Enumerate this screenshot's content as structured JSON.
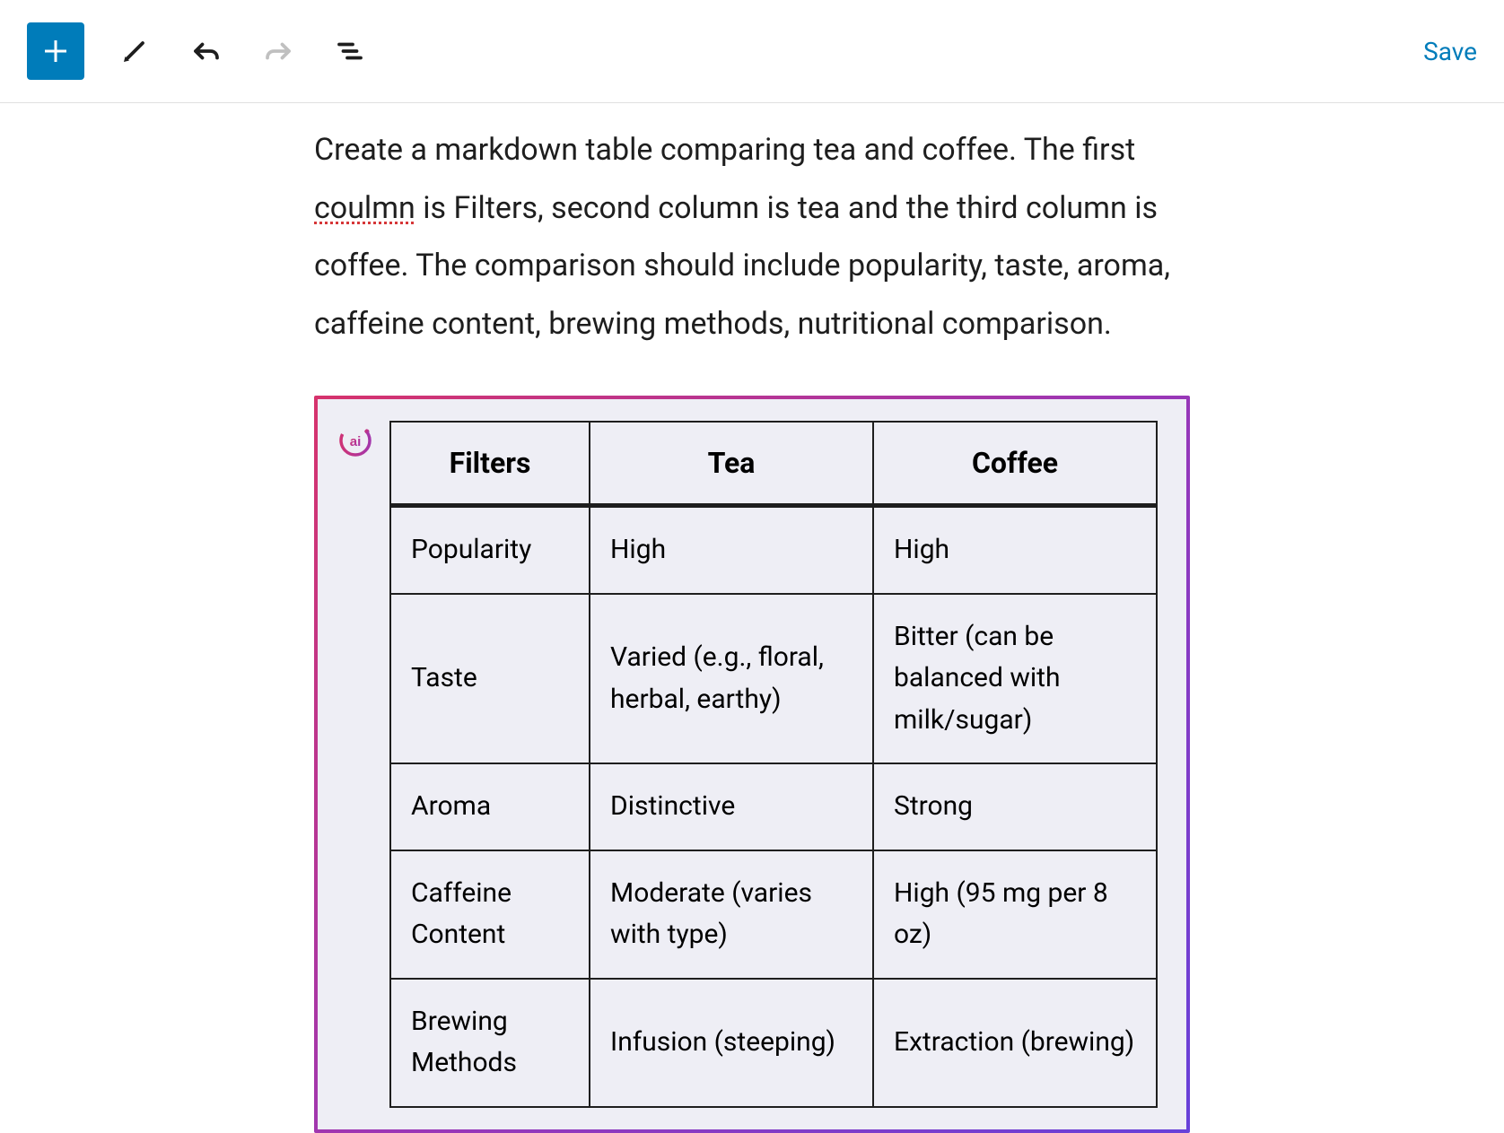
{
  "toolbar": {
    "save_label": "Save"
  },
  "content": {
    "prompt_part1": "Create a markdown table comparing tea and coffee. The first ",
    "prompt_misspelled": "coulmn",
    "prompt_part2": " is Filters, second column is tea and the third column is coffee. The comparison should include popularity, taste, aroma, caffeine content, brewing methods, nutritional comparison."
  },
  "table": {
    "headers": [
      "Filters",
      "Tea",
      "Coffee"
    ],
    "rows": [
      {
        "filter": "Popularity",
        "tea": "High",
        "coffee": "High"
      },
      {
        "filter": "Taste",
        "tea": "Varied (e.g., floral, herbal, earthy)",
        "coffee": "Bitter (can be balanced with milk/sugar)"
      },
      {
        "filter": "Aroma",
        "tea": "Distinctive",
        "coffee": "Strong"
      },
      {
        "filter": "Caffeine Content",
        "tea": "Moderate (varies with type)",
        "coffee": "High (95 mg per 8 oz)"
      },
      {
        "filter": "Brewing Methods",
        "tea": "Infusion (steeping)",
        "coffee": "Extraction (brewing)"
      }
    ]
  }
}
